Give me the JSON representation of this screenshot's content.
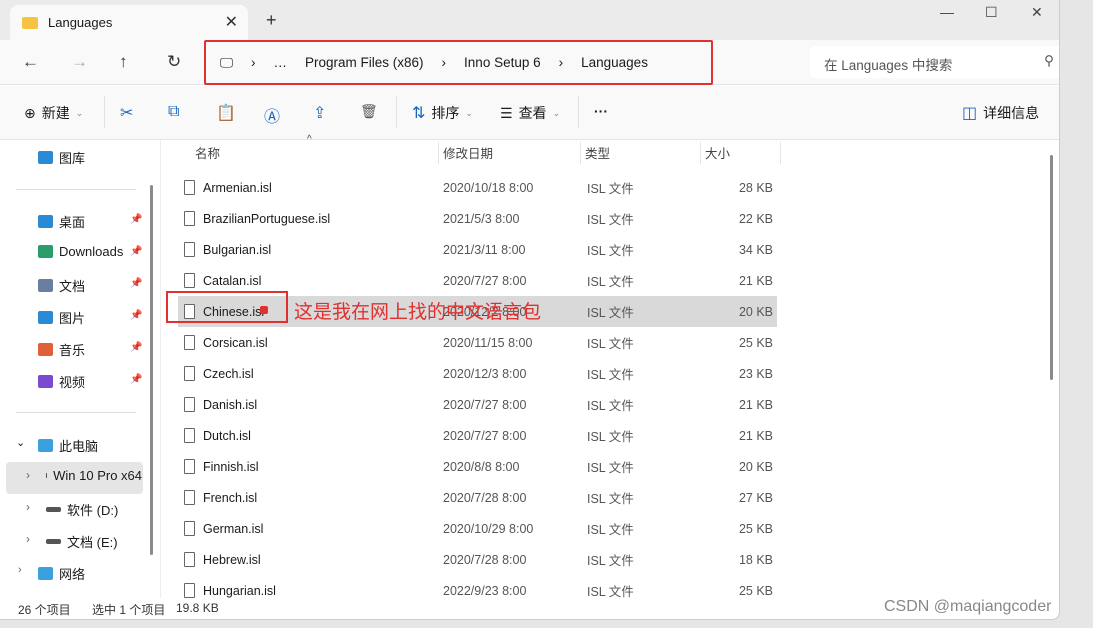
{
  "tab": {
    "title": "Languages",
    "close": "✕",
    "new": "+"
  },
  "window_controls": {
    "minimize": "—",
    "maximize": "☐",
    "close": "✕"
  },
  "breadcrumb": {
    "items": [
      "…",
      "Program Files (x86)",
      "Inno Setup 6",
      "Languages"
    ],
    "sep": "›"
  },
  "search": {
    "placeholder": "在 Languages 中搜索"
  },
  "toolbar": {
    "new": "新建",
    "sort": "排序",
    "view": "查看",
    "more": "···",
    "details": "详细信息"
  },
  "sidebar": {
    "gallery": "图库",
    "quick": [
      {
        "label": "桌面",
        "color": "#2a8ad4"
      },
      {
        "label": "Downloads",
        "color": "#2a9d6a"
      },
      {
        "label": "文档",
        "color": "#6a7fa0"
      },
      {
        "label": "图片",
        "color": "#2a8ad4"
      },
      {
        "label": "音乐",
        "color": "#e0603a"
      },
      {
        "label": "视频",
        "color": "#7a4ad0"
      }
    ],
    "this_pc": "此电脑",
    "drives": [
      "Win 10 Pro x64",
      "软件 (D:)",
      "文档 (E:)"
    ],
    "network": "网络"
  },
  "columns": {
    "name": "名称",
    "date": "修改日期",
    "type": "类型",
    "size": "大小"
  },
  "files": [
    {
      "name": "Armenian.isl",
      "date": "2020/10/18 8:00",
      "type": "ISL 文件",
      "size": "28 KB"
    },
    {
      "name": "BrazilianPortuguese.isl",
      "date": "2021/5/3 8:00",
      "type": "ISL 文件",
      "size": "22 KB"
    },
    {
      "name": "Bulgarian.isl",
      "date": "2021/3/11 8:00",
      "type": "ISL 文件",
      "size": "34 KB"
    },
    {
      "name": "Catalan.isl",
      "date": "2020/7/27 8:00",
      "type": "ISL 文件",
      "size": "21 KB"
    },
    {
      "name": "Chinese.isl",
      "date": "2020/12/2 8:00",
      "type": "ISL 文件",
      "size": "20 KB"
    },
    {
      "name": "Corsican.isl",
      "date": "2020/11/15 8:00",
      "type": "ISL 文件",
      "size": "25 KB"
    },
    {
      "name": "Czech.isl",
      "date": "2020/12/3 8:00",
      "type": "ISL 文件",
      "size": "23 KB"
    },
    {
      "name": "Danish.isl",
      "date": "2020/7/27 8:00",
      "type": "ISL 文件",
      "size": "21 KB"
    },
    {
      "name": "Dutch.isl",
      "date": "2020/7/27 8:00",
      "type": "ISL 文件",
      "size": "21 KB"
    },
    {
      "name": "Finnish.isl",
      "date": "2020/8/8 8:00",
      "type": "ISL 文件",
      "size": "20 KB"
    },
    {
      "name": "French.isl",
      "date": "2020/7/28 8:00",
      "type": "ISL 文件",
      "size": "27 KB"
    },
    {
      "name": "German.isl",
      "date": "2020/10/29 8:00",
      "type": "ISL 文件",
      "size": "25 KB"
    },
    {
      "name": "Hebrew.isl",
      "date": "2020/7/28 8:00",
      "type": "ISL 文件",
      "size": "18 KB"
    },
    {
      "name": "Hungarian.isl",
      "date": "2022/9/23 8:00",
      "type": "ISL 文件",
      "size": "25 KB"
    }
  ],
  "status": {
    "count": "26 个项目",
    "selected": "选中 1 个项目",
    "size": "19.8 KB"
  },
  "annotation": {
    "text": "这是我在网上找的中文语言包",
    "color": "#e03030"
  },
  "watermark": "CSDN @maqiangcoder"
}
